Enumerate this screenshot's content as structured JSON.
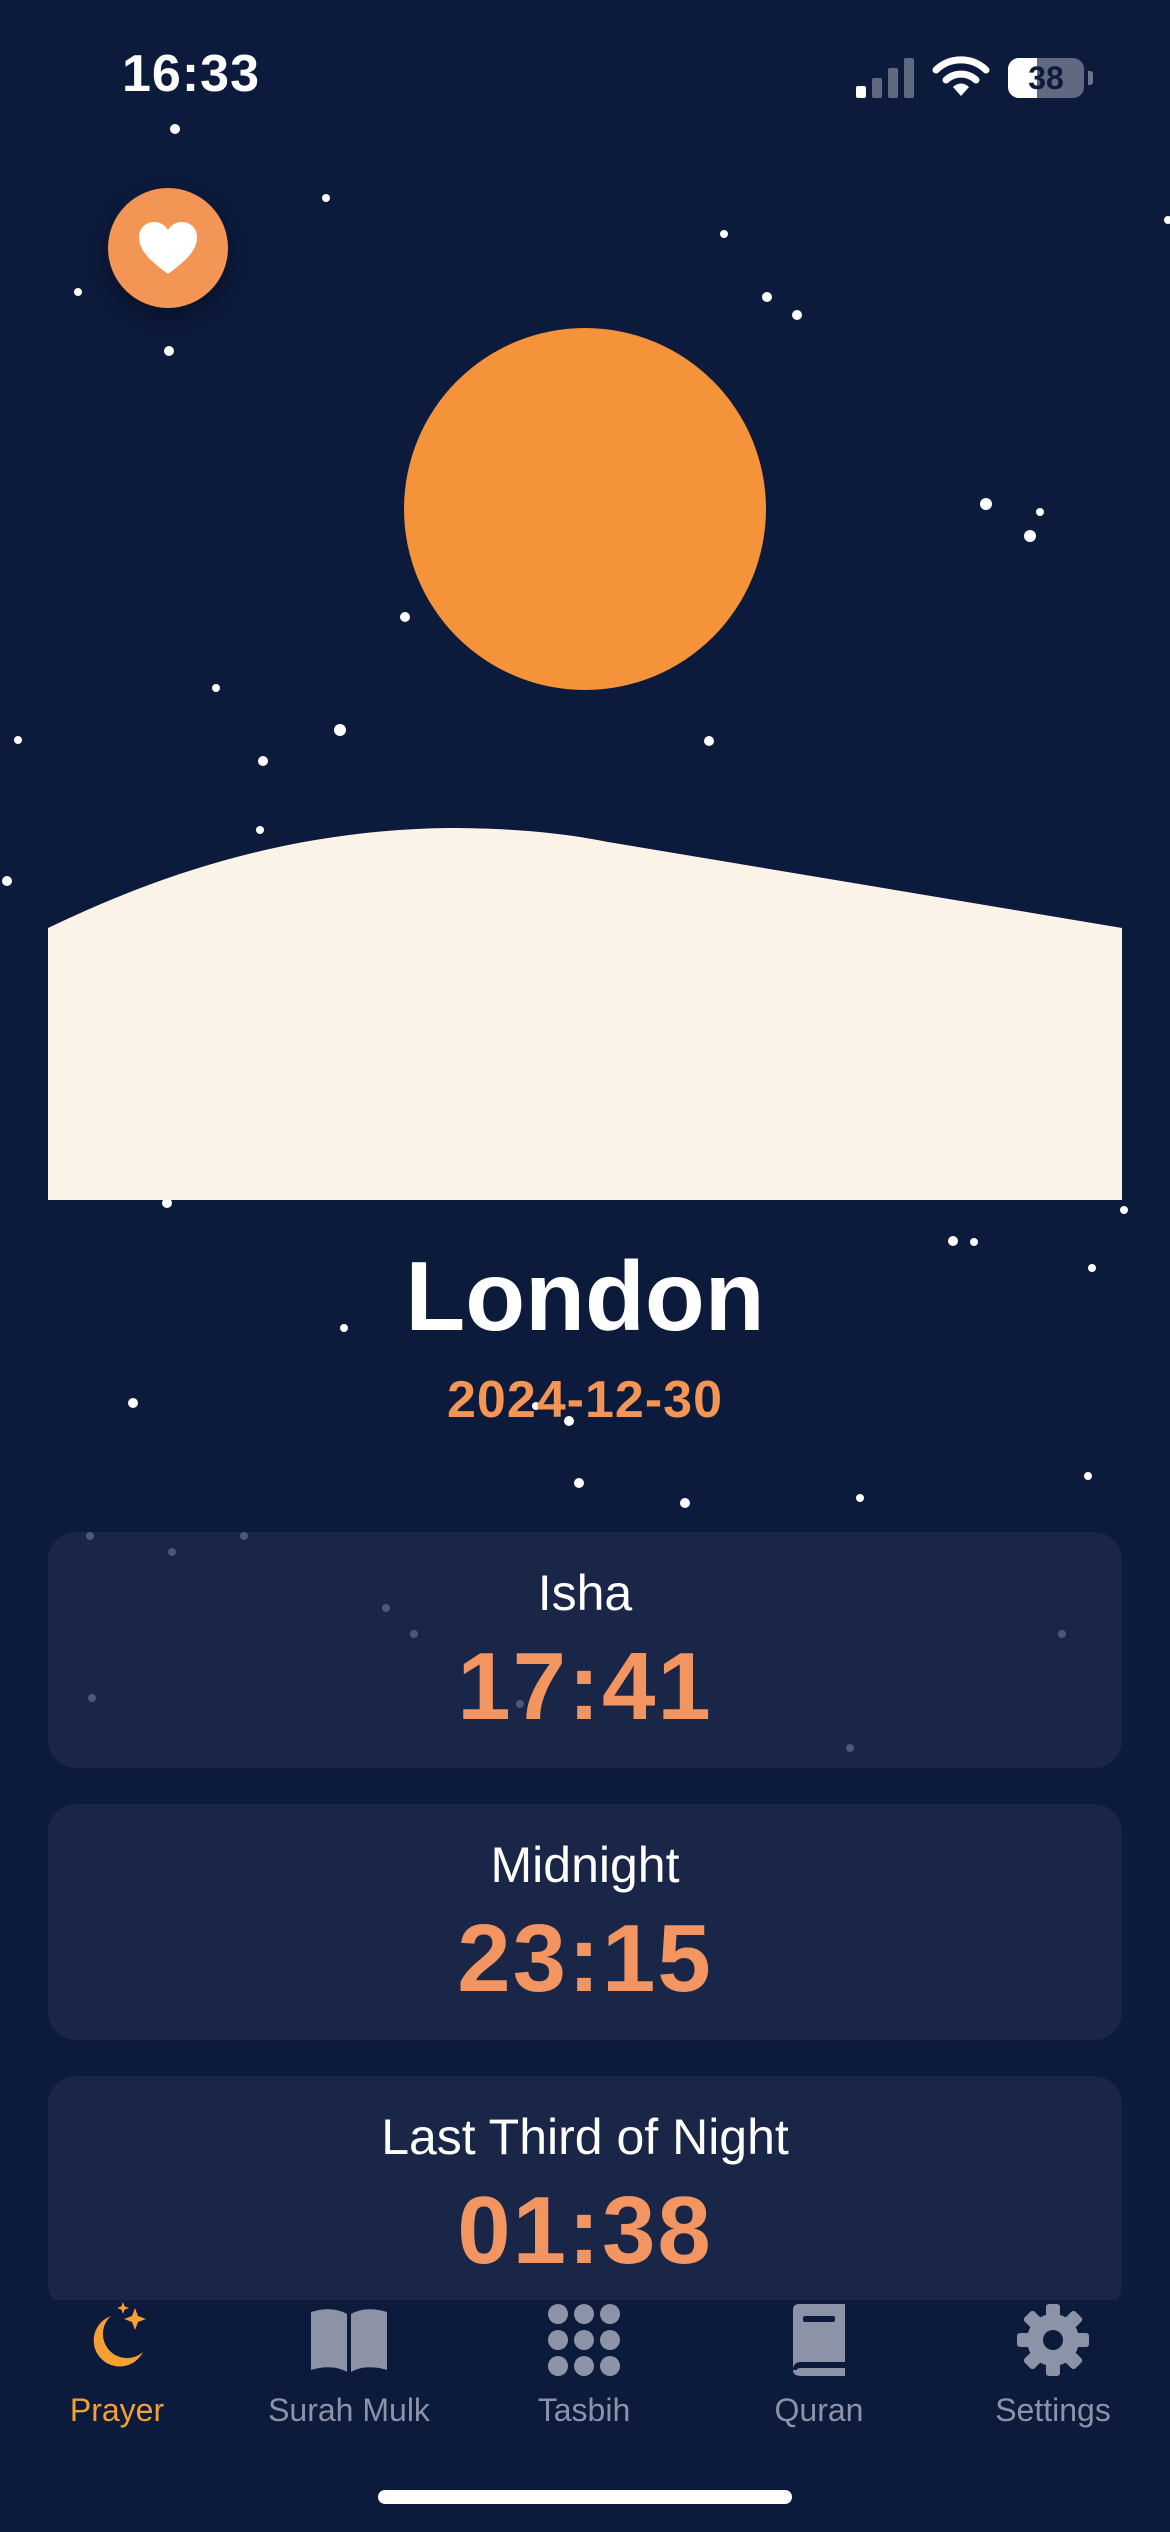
{
  "status_bar": {
    "time": "16:33",
    "battery_level": "38",
    "battery_fraction": 0.38,
    "icons": [
      "signal-icon",
      "wifi-icon",
      "battery-icon"
    ]
  },
  "favorite_button": {
    "icon": "heart-icon"
  },
  "location": {
    "city": "London",
    "date": "2024-12-30"
  },
  "prayer_times": [
    {
      "name": "Isha",
      "time": "17:41"
    },
    {
      "name": "Midnight",
      "time": "23:15"
    },
    {
      "name": "Last Third of Night",
      "time": "01:38"
    }
  ],
  "tab_bar": {
    "tabs": [
      {
        "label": "Prayer",
        "icon": "moon-stars-icon",
        "active": true
      },
      {
        "label": "Surah Mulk",
        "icon": "open-book-icon",
        "active": false
      },
      {
        "label": "Tasbih",
        "icon": "grid-dots-icon",
        "active": false
      },
      {
        "label": "Quran",
        "icon": "book-icon",
        "active": false
      },
      {
        "label": "Settings",
        "icon": "gear-icon",
        "active": false
      }
    ]
  },
  "colors": {
    "background": "#0c1a3c",
    "accent": "#f29555",
    "sun": "#f5933a",
    "card": "#192647",
    "hill": "#fcf3e8",
    "tab_active": "#f5a032",
    "tab_inactive": "#8c93a6"
  }
}
